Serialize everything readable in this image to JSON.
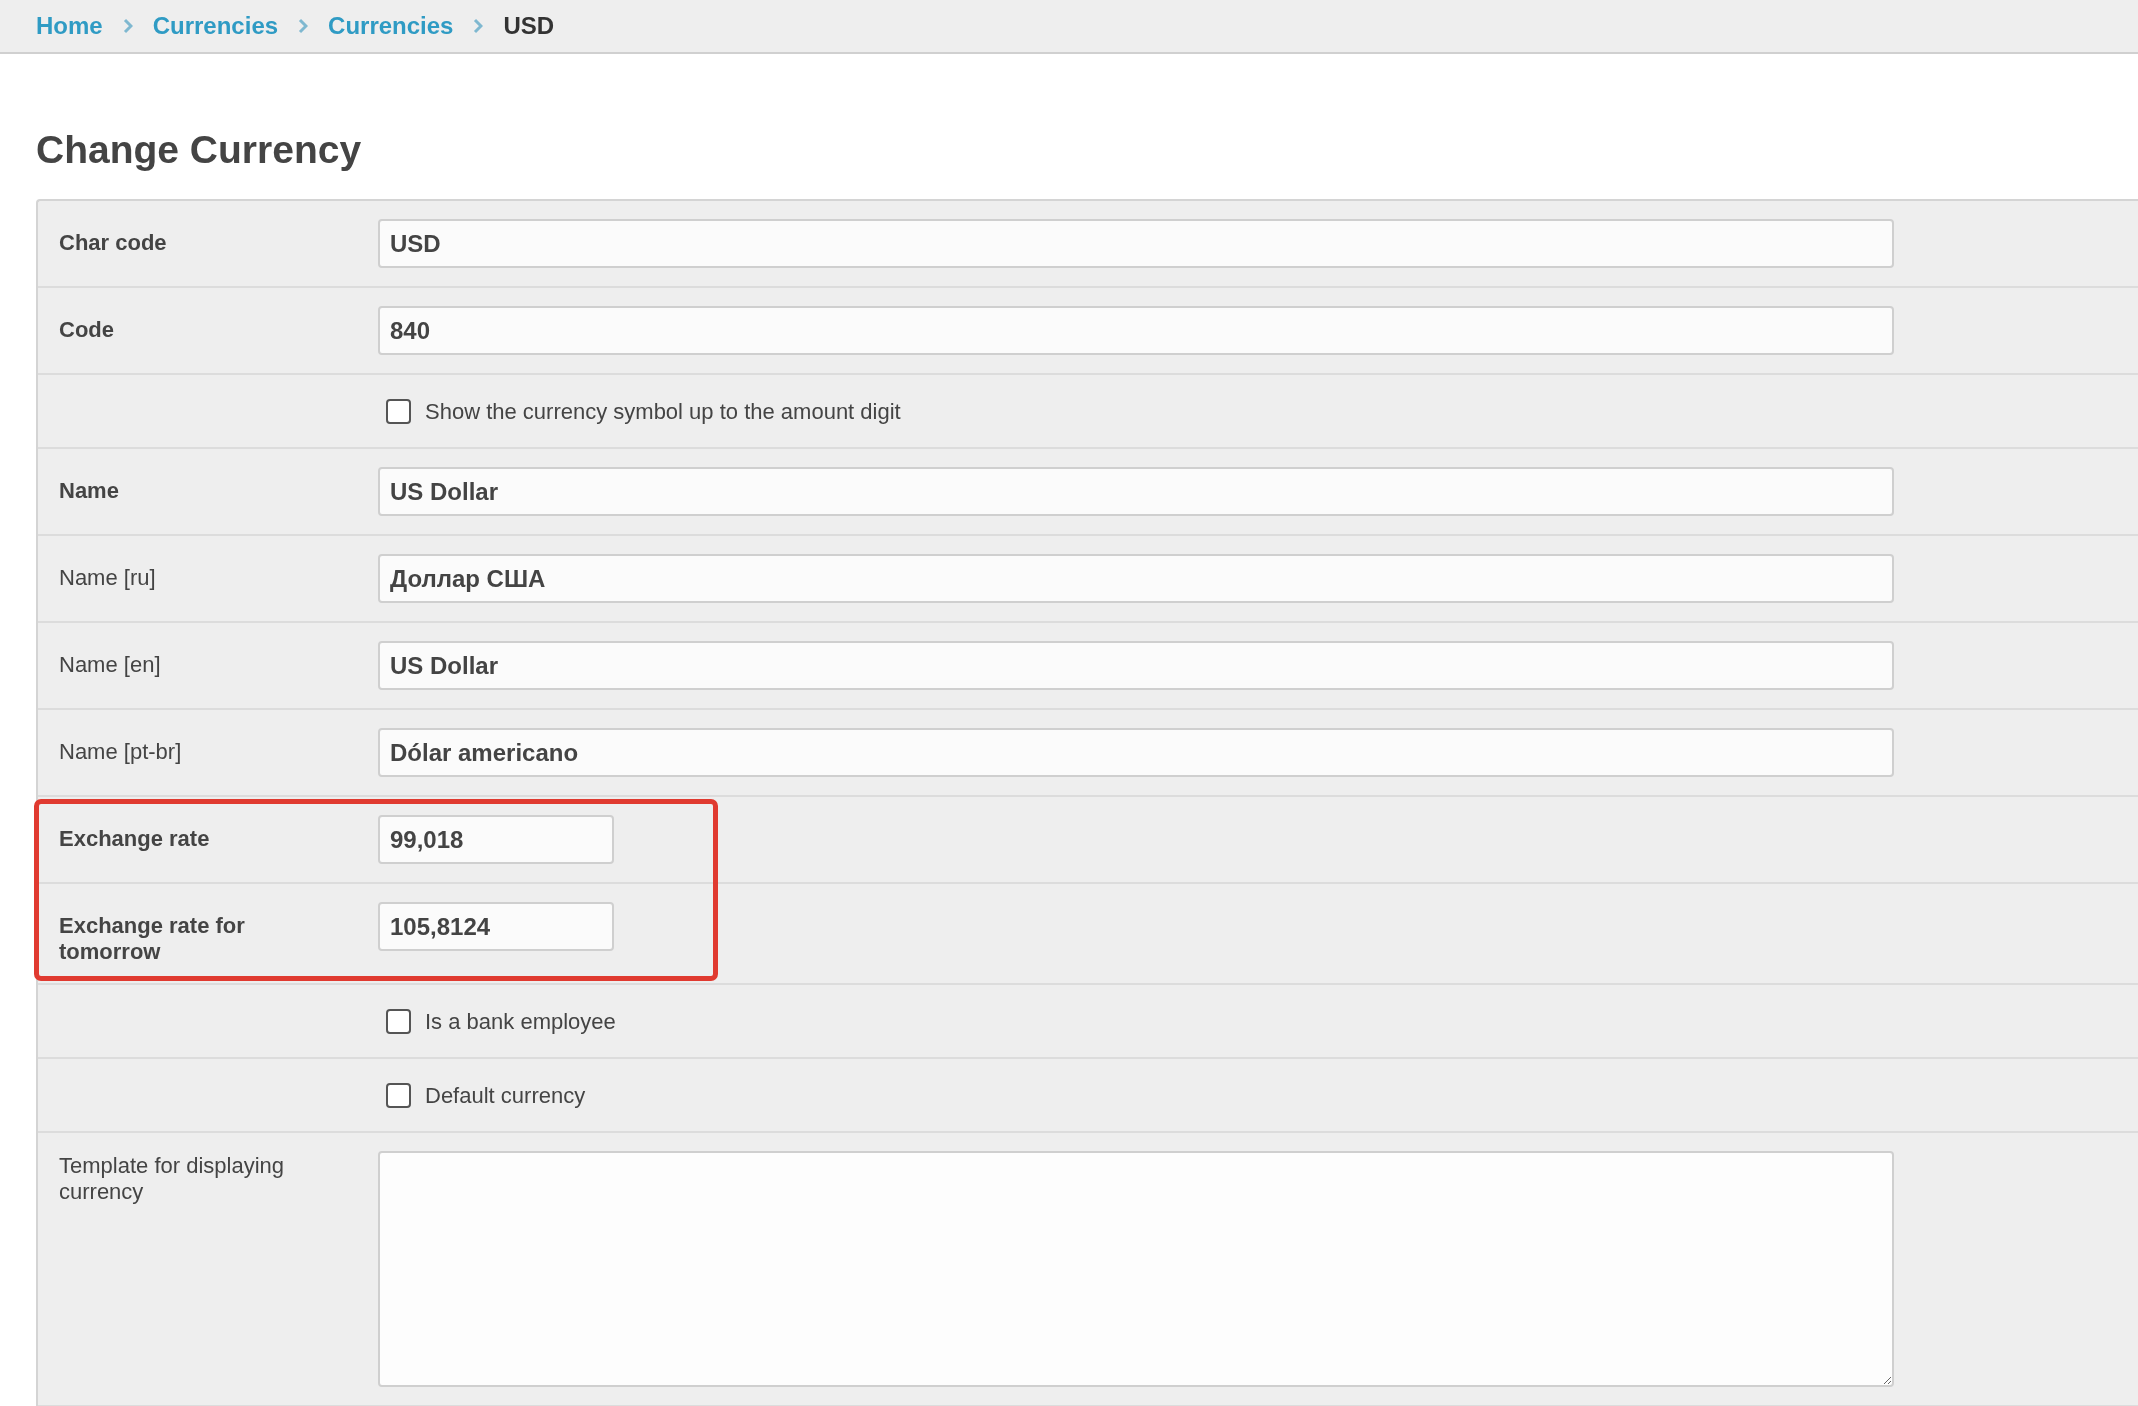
{
  "breadcrumbs": [
    {
      "label": "Home",
      "kind": "link"
    },
    {
      "label": "Currencies",
      "kind": "link"
    },
    {
      "label": "Currencies",
      "kind": "link"
    },
    {
      "label": "USD",
      "kind": "current"
    }
  ],
  "title": "Change Currency",
  "fields": [
    {
      "kind": "text",
      "label": "Char code",
      "required": true,
      "value": "USD",
      "highlighted": false
    },
    {
      "kind": "text",
      "label": "Code",
      "required": true,
      "value": "840",
      "highlighted": false
    },
    {
      "kind": "checkbox",
      "label": "Show the currency symbol up to the amount digit",
      "checked": false,
      "highlighted": false
    },
    {
      "kind": "text",
      "label": "Name",
      "required": true,
      "value": "US Dollar",
      "highlighted": false
    },
    {
      "kind": "text",
      "label": "Name [ru]",
      "required": false,
      "value": "Доллар США",
      "highlighted": false
    },
    {
      "kind": "text",
      "label": "Name [en]",
      "required": false,
      "value": "US Dollar",
      "highlighted": false
    },
    {
      "kind": "text",
      "label": "Name [pt-br]",
      "required": false,
      "value": "Dólar americano",
      "highlighted": false
    },
    {
      "kind": "short_text",
      "label": "Exchange rate",
      "required": true,
      "value": "99,018",
      "highlighted": true
    },
    {
      "kind": "short_text",
      "label": "Exchange rate for tomorrow",
      "required": true,
      "value": "105,8124",
      "highlighted": true
    },
    {
      "kind": "checkbox",
      "label": "Is a bank employee",
      "checked": false,
      "highlighted": false
    },
    {
      "kind": "checkbox",
      "label": "Default currency",
      "checked": false,
      "highlighted": false
    },
    {
      "kind": "textarea",
      "label": "Template for displaying currency",
      "required": false,
      "highlighted": false
    }
  ]
}
